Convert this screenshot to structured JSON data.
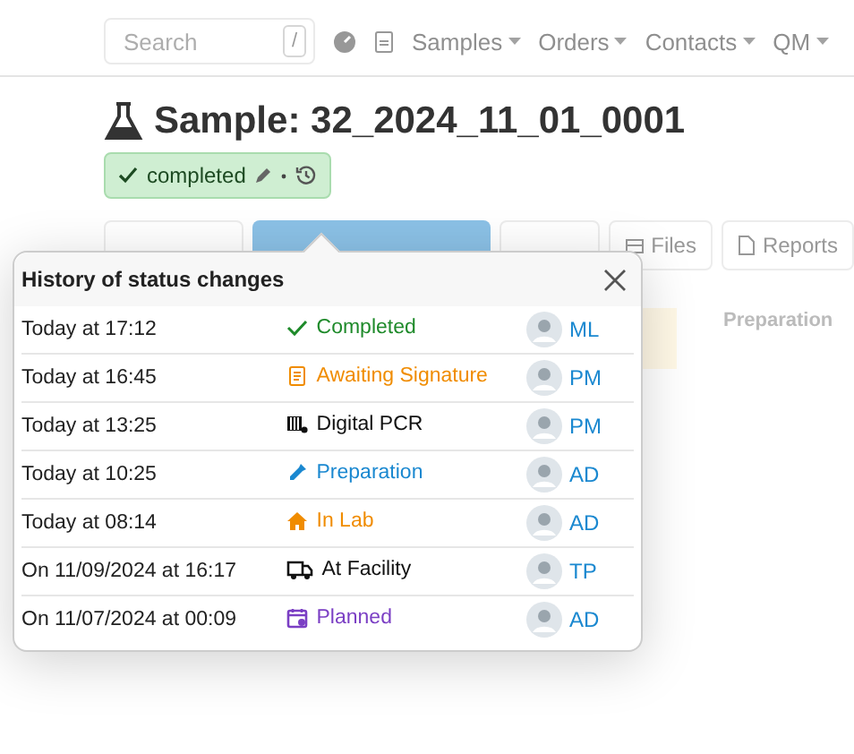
{
  "navbar": {
    "search": {
      "placeholder": "Search",
      "shortcut": "/"
    },
    "menus": [
      "Samples",
      "Orders",
      "Contacts",
      "QM"
    ]
  },
  "title": "Sample: 32_2024_11_01_0001",
  "status_badge": {
    "label": "completed"
  },
  "toolbar": {
    "buttons": [
      {
        "label": "Files",
        "kind": "files"
      },
      {
        "label": "Reports",
        "kind": "reports"
      }
    ]
  },
  "side_label": "Preparation",
  "history": {
    "title": "History of status changes",
    "rows": [
      {
        "time": "Today at 17:12",
        "status": "Completed",
        "kind": "completed",
        "color": "#1e8a2a",
        "user": "ML"
      },
      {
        "time": "Today at 16:45",
        "status": "Awaiting Signature",
        "kind": "signature",
        "color": "#f08c00",
        "user": "PM"
      },
      {
        "time": "Today at 13:25",
        "status": "Digital PCR",
        "kind": "pcr",
        "color": "#111111",
        "user": "PM"
      },
      {
        "time": "Today at 10:25",
        "status": "Preparation",
        "kind": "preparation",
        "color": "#1a88d0",
        "user": "AD"
      },
      {
        "time": "Today at 08:14",
        "status": "In Lab",
        "kind": "lab",
        "color": "#f08c00",
        "user": "AD"
      },
      {
        "time": "On 11/09/2024 at 16:17",
        "status": "At Facility",
        "kind": "facility",
        "color": "#111111",
        "user": "TP"
      },
      {
        "time": "On 11/07/2024 at 00:09",
        "status": "Planned",
        "kind": "planned",
        "color": "#7b3fc4",
        "user": "AD"
      }
    ]
  }
}
